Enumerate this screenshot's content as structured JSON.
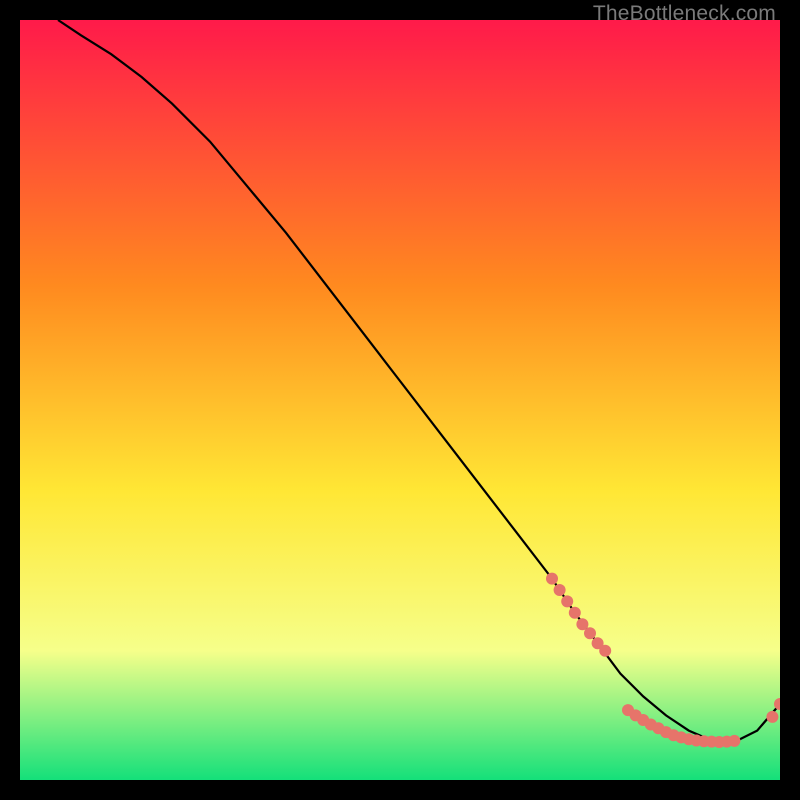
{
  "watermark": "TheBottleneck.com",
  "colors": {
    "background": "#000000",
    "gradient_top": "#ff1a4a",
    "gradient_mid1": "#ff8a1f",
    "gradient_mid2": "#ffe735",
    "gradient_mid3": "#f6ff8a",
    "gradient_bottom": "#14e07a",
    "curve": "#000000",
    "marker": "#e6746a"
  },
  "chart_data": {
    "type": "line",
    "title": "",
    "xlabel": "",
    "ylabel": "",
    "xlim": [
      0,
      100
    ],
    "ylim": [
      0,
      100
    ],
    "curve": {
      "x": [
        5,
        8,
        12,
        16,
        20,
        25,
        30,
        35,
        40,
        45,
        50,
        55,
        60,
        65,
        70,
        73,
        76,
        79,
        82,
        85,
        88,
        91,
        94,
        97,
        100
      ],
      "y": [
        100,
        98,
        95.5,
        92.5,
        89,
        84,
        78,
        72,
        65.5,
        59,
        52.5,
        46,
        39.5,
        33,
        26.5,
        22,
        18,
        14,
        11,
        8.5,
        6.5,
        5.2,
        5,
        6.5,
        10
      ]
    },
    "series": [
      {
        "name": "markers-descent",
        "x": [
          70,
          71,
          72,
          73,
          74,
          75,
          76,
          77
        ],
        "y": [
          26.5,
          25,
          23.5,
          22,
          20.5,
          19.3,
          18,
          17
        ]
      },
      {
        "name": "markers-bottom",
        "x": [
          80,
          81,
          82,
          83,
          84,
          85,
          86,
          87,
          88,
          89,
          90,
          91,
          92,
          93,
          94
        ],
        "y": [
          9.2,
          8.5,
          7.9,
          7.3,
          6.8,
          6.3,
          5.9,
          5.6,
          5.35,
          5.2,
          5.1,
          5.05,
          5.0,
          5.05,
          5.15
        ]
      },
      {
        "name": "markers-rise",
        "x": [
          99,
          100
        ],
        "y": [
          8.3,
          10
        ]
      }
    ]
  }
}
